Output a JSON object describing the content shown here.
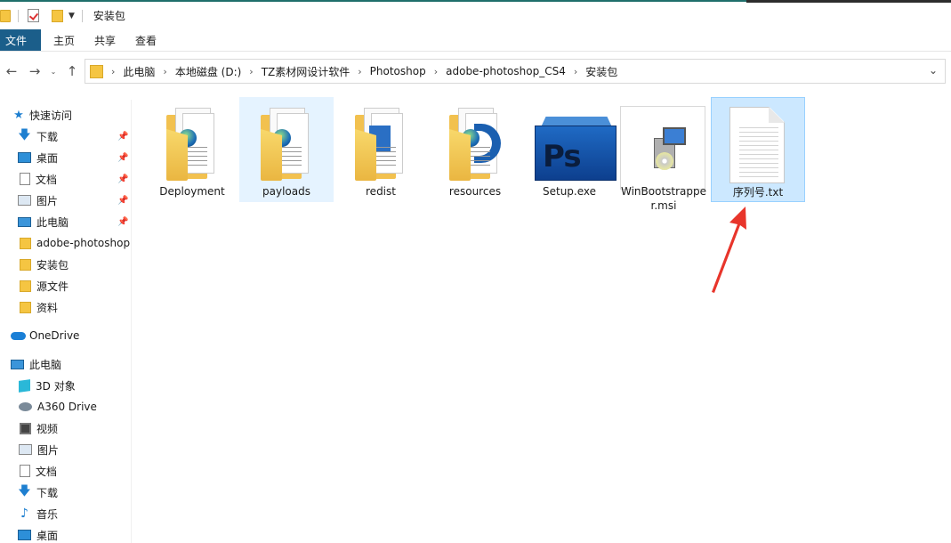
{
  "window": {
    "title": "安装包"
  },
  "ribbon": {
    "tabs": [
      "文件",
      "主页",
      "共享",
      "查看"
    ]
  },
  "address": {
    "crumbs": [
      "此电脑",
      "本地磁盘 (D:)",
      "TZ素材网设计软件",
      "Photoshop",
      "adobe-photoshop_CS4",
      "安装包"
    ]
  },
  "sidebar": {
    "quick_access": "快速访问",
    "items": [
      {
        "label": "下载",
        "pinned": true
      },
      {
        "label": "桌面",
        "pinned": true
      },
      {
        "label": "文档",
        "pinned": true
      },
      {
        "label": "图片",
        "pinned": true
      },
      {
        "label": "此电脑",
        "pinned": true
      },
      {
        "label": "adobe-photoshop"
      },
      {
        "label": "安装包"
      },
      {
        "label": "源文件"
      },
      {
        "label": "资料"
      }
    ],
    "onedrive": "OneDrive",
    "this_pc": "此电脑",
    "pc_items": [
      "3D 对象",
      "A360 Drive",
      "视频",
      "图片",
      "文档",
      "下载",
      "音乐",
      "桌面"
    ]
  },
  "files": [
    {
      "name": "Deployment",
      "type": "folder-globe"
    },
    {
      "name": "payloads",
      "type": "folder-globe",
      "state": "hover"
    },
    {
      "name": "redist",
      "type": "folder-doc"
    },
    {
      "name": "resources",
      "type": "folder-blue"
    },
    {
      "name": "Setup.exe",
      "type": "photoshop"
    },
    {
      "name": "WinBootstrapper.msi",
      "type": "msi"
    },
    {
      "name": "序列号.txt",
      "type": "text",
      "state": "selected"
    }
  ],
  "colors": {
    "accent": "#1b5e8a",
    "selection": "#cce8ff",
    "annotation": "#e8352b"
  }
}
